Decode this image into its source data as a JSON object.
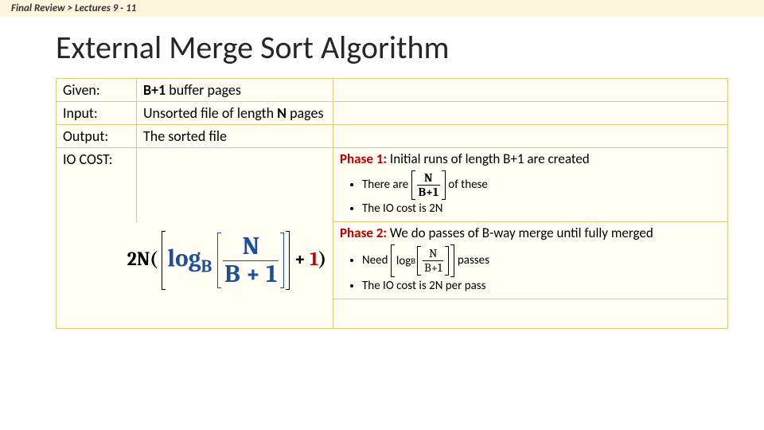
{
  "breadcrumb": "Final Review  >  Lectures 9 - 11",
  "title": "External Merge Sort Algorithm",
  "rows": {
    "given": {
      "label": "Given:",
      "value_pre": "B+1",
      "value_post": " buffer pages"
    },
    "input": {
      "label": "Input:",
      "value_pre": "Unsorted file of length ",
      "value_b": "N",
      "value_post": " pages"
    },
    "output": {
      "label": "Output:",
      "value": "The sorted file"
    },
    "iocost": {
      "label": "IO COST:"
    }
  },
  "phase1": {
    "head": "Phase 1:",
    "text": " Initial runs of length B+1 are created",
    "b1_pre": "There are ",
    "b1_post": " of these",
    "b2": "The IO cost is 2N"
  },
  "phase2": {
    "head": "Phase 2:",
    "text": " We do passes of B-way merge until fully merged",
    "b1_pre": "Need ",
    "b1_post": " passes",
    "b2": "The IO cost is 2N per pass"
  },
  "math": {
    "N": "N",
    "Bp1": "B+1",
    "B": "B",
    "one": "1",
    "twoNopen": "2N(",
    "logB": "log",
    "plus": " + ",
    "close": ")"
  }
}
